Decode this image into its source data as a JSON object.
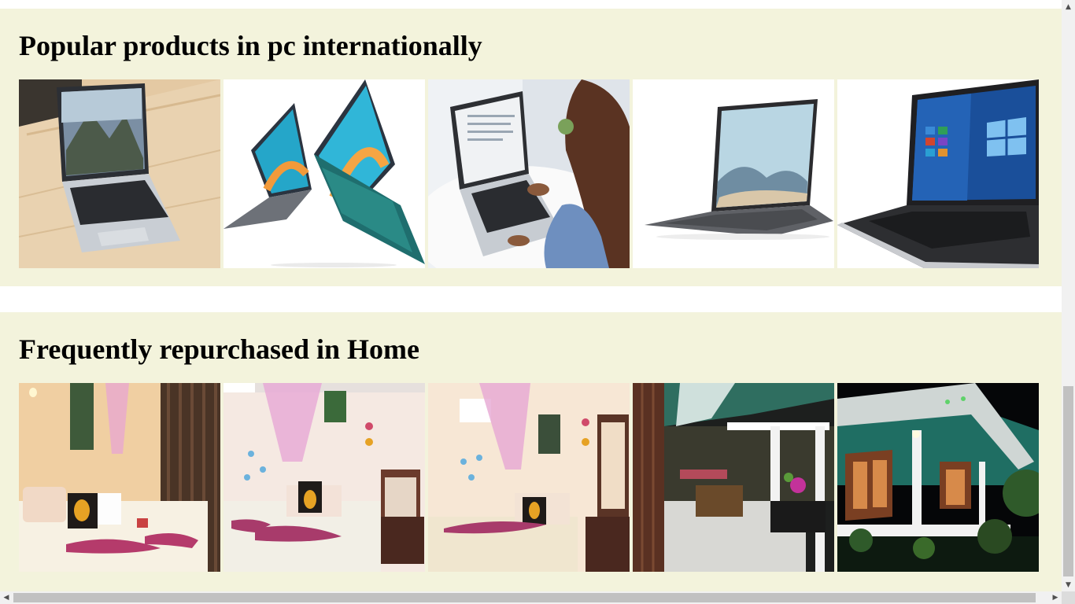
{
  "sections": {
    "pc": {
      "title": "Popular products in pc internationally",
      "products": [
        {
          "icon": "laptop-on-wood-desk-image"
        },
        {
          "icon": "two-laptops-image"
        },
        {
          "icon": "woman-using-laptop-image"
        },
        {
          "icon": "surface-laptop-image"
        },
        {
          "icon": "hp-laptop-windows-image"
        }
      ]
    },
    "home": {
      "title": "Frequently repurchased in Home",
      "products": [
        {
          "icon": "bedroom-curtains-image"
        },
        {
          "icon": "bedroom-mosquito-net-image"
        },
        {
          "icon": "bedroom-butterflies-image"
        },
        {
          "icon": "veranda-dining-image"
        },
        {
          "icon": "house-exterior-night-image"
        }
      ]
    }
  },
  "colors": {
    "section_bg": "#f3f3dc",
    "page_bg": "#ffffff",
    "scrollbar_thumb": "#c1c1c1"
  },
  "scrollbars": {
    "up_arrow": "▲",
    "down_arrow": "▼",
    "left_arrow": "◀",
    "right_arrow": "▶"
  }
}
